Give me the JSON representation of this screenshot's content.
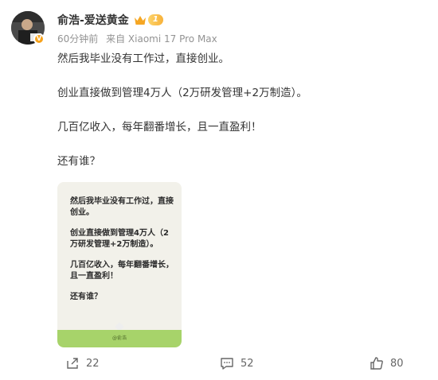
{
  "post": {
    "author": "俞浩-爱送黄金",
    "level": "1",
    "time": "60分钟前",
    "source": "来自 Xiaomi 17 Pro Max",
    "paragraphs": [
      "然后我毕业没有工作过，直接创业。",
      "创业直接做到管理4万人（2万研发管理+2万制造）。",
      "几百亿收入，每年翻番增长，且一直盈利！",
      "还有谁？"
    ]
  },
  "image": {
    "lines": [
      "然后我毕业没有工作过，直接创业。",
      "创业直接做到管理4万人（2万研发管理+2万制造）。",
      "几百亿收入，每年翻番增长，且一直盈利！",
      "还有谁？"
    ],
    "footer_label": "@俞浩"
  },
  "actions": {
    "repost_count": "22",
    "comment_count": "52",
    "like_count": "80"
  },
  "colors": {
    "accent": "#f7a21b",
    "highlight": "#f1973d",
    "footer_green": "#a7d36a"
  }
}
